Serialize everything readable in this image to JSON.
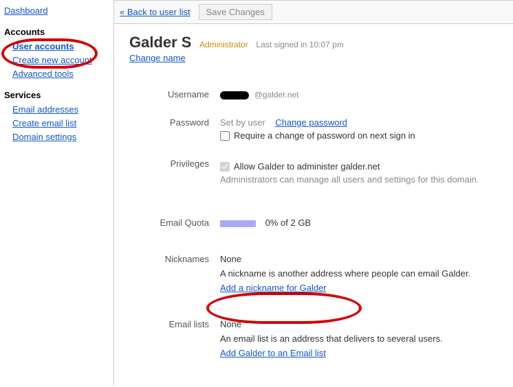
{
  "sidebar": {
    "dashboard": "Dashboard",
    "accounts_header": "Accounts",
    "accounts": {
      "user_accounts": "User accounts",
      "create_new": "Create new account",
      "advanced_tools": "Advanced tools"
    },
    "services_header": "Services",
    "services": {
      "email_addresses": "Email addresses",
      "create_email_list": "Create email list",
      "domain_settings": "Domain settings"
    }
  },
  "toolbar": {
    "back": "« Back to user list",
    "save": "Save Changes"
  },
  "header": {
    "name": "Galder S",
    "role": "Administrator",
    "signed_in": "Last signed in 10:07 pm",
    "change_name": "Change name"
  },
  "fields": {
    "username": {
      "label": "Username",
      "domain": "@galder.net"
    },
    "password": {
      "label": "Password",
      "set_by": "Set by user",
      "change_link": "Change password",
      "require_change": "Require a change of password on next sign in",
      "require_change_checked": false
    },
    "privileges": {
      "label": "Privileges",
      "allow": "Allow Galder to administer galder.net",
      "allow_checked": true,
      "note": "Administrators can manage all users and settings for this domain."
    },
    "quota": {
      "label": "Email Quota",
      "text": "0% of 2 GB"
    },
    "nicknames": {
      "label": "Nicknames",
      "none": "None",
      "desc": "A nickname is another address where people can email Galder.",
      "add_link": "Add a nickname for Galder"
    },
    "emaillists": {
      "label": "Email lists",
      "none": "None",
      "desc": "An email list is an address that delivers to several users.",
      "add_link": "Add Galder to an Email list"
    }
  }
}
